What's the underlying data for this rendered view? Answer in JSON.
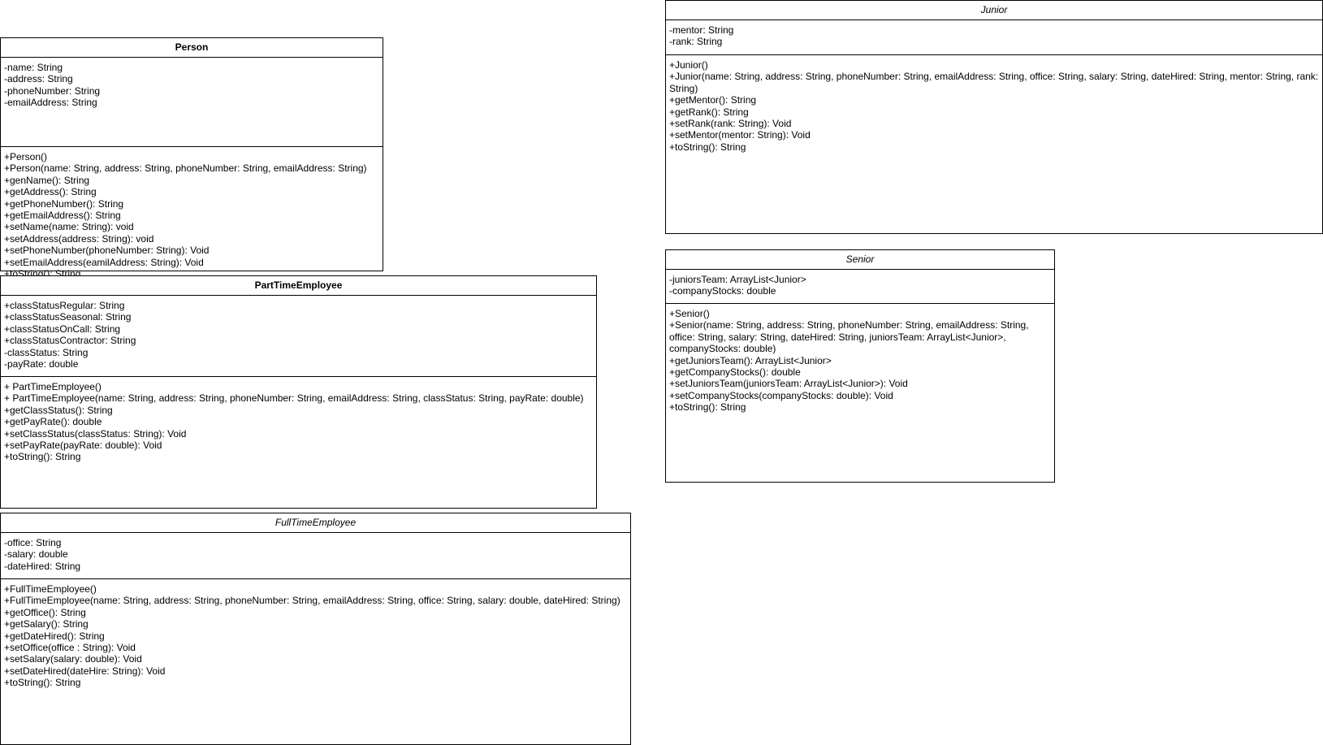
{
  "classes": [
    {
      "id": "person",
      "title": "Person",
      "title_style": "bold",
      "attributes": [
        "-name: String",
        "-address: String",
        "-phoneNumber: String",
        "-emailAddress: String"
      ],
      "methods": [
        "+Person()",
        "+Person(name: String, address: String, phoneNumber: String, emailAddress: String)",
        "+genName(): String",
        "+getAddress(): String",
        "+getPhoneNumber(): String",
        "+getEmailAddress(): String",
        "+setName(name: String): void",
        "+setAddress(address: String): void",
        "+setPhoneNumber(phoneNumber: String): Void",
        "+setEmailAddress(eamilAddress: String): Void",
        "+toString(): String"
      ]
    },
    {
      "id": "parttimeemployee",
      "title": "PartTimeEmployee",
      "title_style": "bold",
      "attributes": [
        "+classStatusRegular: String",
        "+classStatusSeasonal: String",
        "+classStatusOnCall: String",
        "+classStatusContractor: String",
        "-classStatus: String",
        "-payRate: double"
      ],
      "methods": [
        "+ PartTimeEmployee()",
        "+ PartTimeEmployee(name: String, address: String, phoneNumber: String, emailAddress: String, classStatus: String, payRate: double)",
        "+getClassStatus(): String",
        "+getPayRate(): double",
        "+setClassStatus(classStatus: String): Void",
        "+setPayRate(payRate: double): Void",
        "+toString(): String"
      ]
    },
    {
      "id": "fulltimeemployee",
      "title": "FullTimeEmployee",
      "title_style": "italic",
      "attributes": [
        "-office: String",
        "-salary: double",
        "-dateHired: String"
      ],
      "methods": [
        "+FullTimeEmployee()",
        "+FullTimeEmployee(name: String, address: String, phoneNumber: String, emailAddress: String, office: String, salary: double, dateHired: String)",
        "+getOffice(): String",
        "+getSalary(): String",
        "+getDateHired(): String",
        "+setOffice(office : String): Void",
        "+setSalary(salary: double): Void",
        "+setDateHired(dateHire: String): Void",
        "+toString(): String"
      ]
    },
    {
      "id": "junior",
      "title": "Junior",
      "title_style": "italic",
      "attributes": [
        "-mentor: String",
        "-rank: String"
      ],
      "methods": [
        "+Junior()",
        "+Junior(name: String, address: String, phoneNumber: String, emailAddress: String, office: String, salary: String, dateHired: String, mentor: String, rank: String)",
        "+getMentor(): String",
        "+getRank(): String",
        "+setRank(rank: String): Void",
        "+setMentor(mentor: String): Void",
        "+toString(): String"
      ]
    },
    {
      "id": "senior",
      "title": "Senior",
      "title_style": "italic",
      "attributes": [
        "-juniorsTeam: ArrayList<Junior>",
        "-companyStocks: double"
      ],
      "methods": [
        "+Senior()",
        "+Senior(name: String, address: String, phoneNumber: String, emailAddress: String, office: String, salary: String, dateHired: String, juniorsTeam: ArrayList<Junior>, companyStocks: double)",
        "+getJuniorsTeam(): ArrayList<Junior>",
        "+getCompanyStocks(): double",
        "+setJuniorsTeam(juniorsTeam: ArrayList<Junior>): Void",
        "+setCompanyStocks(companyStocks: double): Void",
        "+toString(): String"
      ]
    }
  ]
}
